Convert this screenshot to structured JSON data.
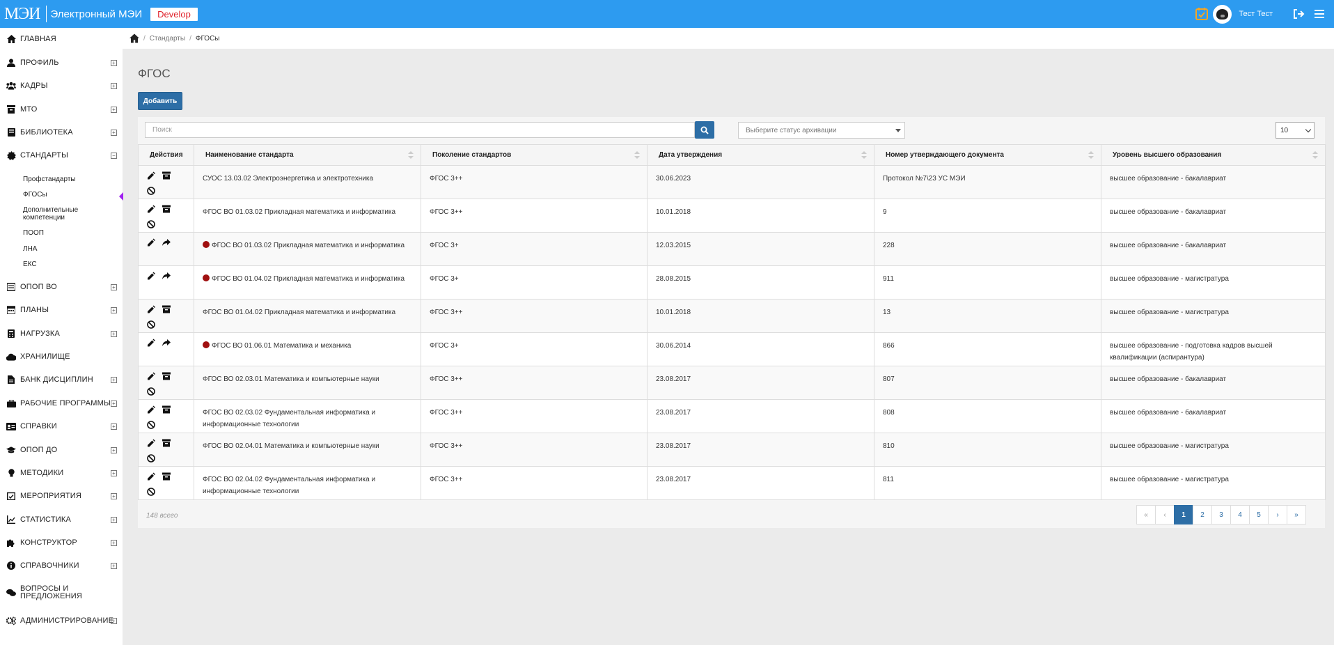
{
  "header": {
    "logo_text": "МЭИ",
    "app_title": "Электронный МЭИ",
    "env_badge": "Develop",
    "user_name": "Тест Тест"
  },
  "sidebar": {
    "items": [
      {
        "label": "ГЛАВНАЯ",
        "icon": "home-icon",
        "expander": false
      },
      {
        "label": "ПРОФИЛЬ",
        "icon": "user-icon",
        "expander": true
      },
      {
        "label": "КАДРЫ",
        "icon": "users-icon",
        "expander": true
      },
      {
        "label": "МТО",
        "icon": "archive-icon",
        "expander": true
      },
      {
        "label": "БИБЛИОТЕКА",
        "icon": "book-icon",
        "expander": true
      },
      {
        "label": "СТАНДАРТЫ",
        "icon": "certificate-icon",
        "expander": true
      },
      {
        "label": "ОПОП ВО",
        "icon": "list-icon",
        "expander": true
      },
      {
        "label": "ПЛАНЫ",
        "icon": "calendar-icon",
        "expander": true
      },
      {
        "label": "НАГРУЗКА",
        "icon": "calculator-icon",
        "expander": true
      },
      {
        "label": "ХРАНИЛИЩЕ",
        "icon": "cloud-icon",
        "expander": false
      },
      {
        "label": "БАНК ДИСЦИПЛИН",
        "icon": "document-icon",
        "expander": true
      },
      {
        "label": "РАБОЧИЕ ПРОГРАММЫ",
        "icon": "briefcase-icon",
        "expander": true
      },
      {
        "label": "СПРАВКИ",
        "icon": "id-card-icon",
        "expander": true
      },
      {
        "label": "ОПОП ДО",
        "icon": "graduation-cap-icon",
        "expander": true
      },
      {
        "label": "МЕТОДИКИ",
        "icon": "lightbulb-icon",
        "expander": true
      },
      {
        "label": "МЕРОПРИЯТИЯ",
        "icon": "calendar-check-icon",
        "expander": true
      },
      {
        "label": "СТАТИСТИКА",
        "icon": "chart-icon",
        "expander": true
      },
      {
        "label": "КОНСТРУКТОР",
        "icon": "puzzle-icon",
        "expander": true
      },
      {
        "label": "СПРАВОЧНИКИ",
        "icon": "info-icon",
        "expander": true
      },
      {
        "label": "ВОПРОСЫ И ПРЕДЛОЖЕНИЯ",
        "icon": "comments-icon",
        "expander": false
      },
      {
        "label": "АДМИНИСТРИРОВАНИЕ",
        "icon": "cogs-icon",
        "expander": true
      }
    ],
    "expander_open": "−",
    "expander_closed": "+",
    "subitems": [
      "Профстандарты",
      "ФГОСы",
      "Дополнительные компетенции",
      "ПООП",
      "ЛНА",
      "ЕКС"
    ]
  },
  "breadcrumb": {
    "items": [
      "Стандарты",
      "ФГОСы"
    ],
    "separator": "/"
  },
  "page": {
    "title": "ФГОС",
    "add_label": "Добавить",
    "search_placeholder": "Поиск",
    "archive_placeholder": "Выберите статус архивации",
    "per_page": "10",
    "total": "148 всего"
  },
  "table": {
    "columns": [
      "Действия",
      "Наименование стандарта",
      "Поколение стандартов",
      "Дата утверждения",
      "Номер утверждающего документа",
      "Уровень высшего образования"
    ],
    "rows": [
      {
        "name": "СУОС 13.03.02 Электроэнергетика и электротехника",
        "generation": "ФГОС 3++",
        "date": "30.06.2023",
        "doc": "Протокол №7\\23 УС МЭИ",
        "level": "высшее образование - бакалавриат",
        "archived": false
      },
      {
        "name": "ФГОС ВО 01.03.02 Прикладная математика и информатика",
        "generation": "ФГОС 3++",
        "date": "10.01.2018",
        "doc": "9",
        "level": "высшее образование - бакалавриат",
        "archived": false
      },
      {
        "name": "ФГОС ВО 01.03.02 Прикладная математика и информатика",
        "generation": "ФГОС 3+",
        "date": "12.03.2015",
        "doc": "228",
        "level": "высшее образование - бакалавриат",
        "archived": true
      },
      {
        "name": "ФГОС ВО 01.04.02 Прикладная математика и информатика",
        "generation": "ФГОС 3+",
        "date": "28.08.2015",
        "doc": "911",
        "level": "высшее образование - магистратура",
        "archived": true
      },
      {
        "name": "ФГОС ВО 01.04.02 Прикладная математика и информатика",
        "generation": "ФГОС 3++",
        "date": "10.01.2018",
        "doc": "13",
        "level": "высшее образование - магистратура",
        "archived": false
      },
      {
        "name": "ФГОС ВО 01.06.01 Математика и механика",
        "generation": "ФГОС 3+",
        "date": "30.06.2014",
        "doc": "866",
        "level": "высшее образование - подготовка кадров высшей квалификации (аспирантура)",
        "archived": true
      },
      {
        "name": "ФГОС ВО 02.03.01 Математика и компьютерные науки",
        "generation": "ФГОС 3++",
        "date": "23.08.2017",
        "doc": "807",
        "level": "высшее образование - бакалавриат",
        "archived": false
      },
      {
        "name": "ФГОС ВО 02.03.02 Фундаментальная информатика и информационные технологии",
        "generation": "ФГОС 3++",
        "date": "23.08.2017",
        "doc": "808",
        "level": "высшее образование - бакалавриат",
        "archived": false
      },
      {
        "name": "ФГОС ВО 02.04.01 Математика и компьютерные науки",
        "generation": "ФГОС 3++",
        "date": "23.08.2017",
        "doc": "810",
        "level": "высшее образование - магистратура",
        "archived": false
      },
      {
        "name": "ФГОС ВО 02.04.02 Фундаментальная информатика и информационные технологии",
        "generation": "ФГОС 3++",
        "date": "23.08.2017",
        "doc": "811",
        "level": "высшее образование - магистратура",
        "archived": false
      }
    ]
  },
  "pagination": {
    "first": "«",
    "prev": "‹",
    "pages": [
      "1",
      "2",
      "3",
      "4",
      "5"
    ],
    "next": "›",
    "last": "»",
    "current": "1"
  },
  "colors": {
    "topbar": "#2d9bf0",
    "primary_button": "#2d6ea6",
    "archived_dot": "#a01010",
    "active_marker": "#a020f0",
    "env_badge_text": "#e0202a"
  }
}
